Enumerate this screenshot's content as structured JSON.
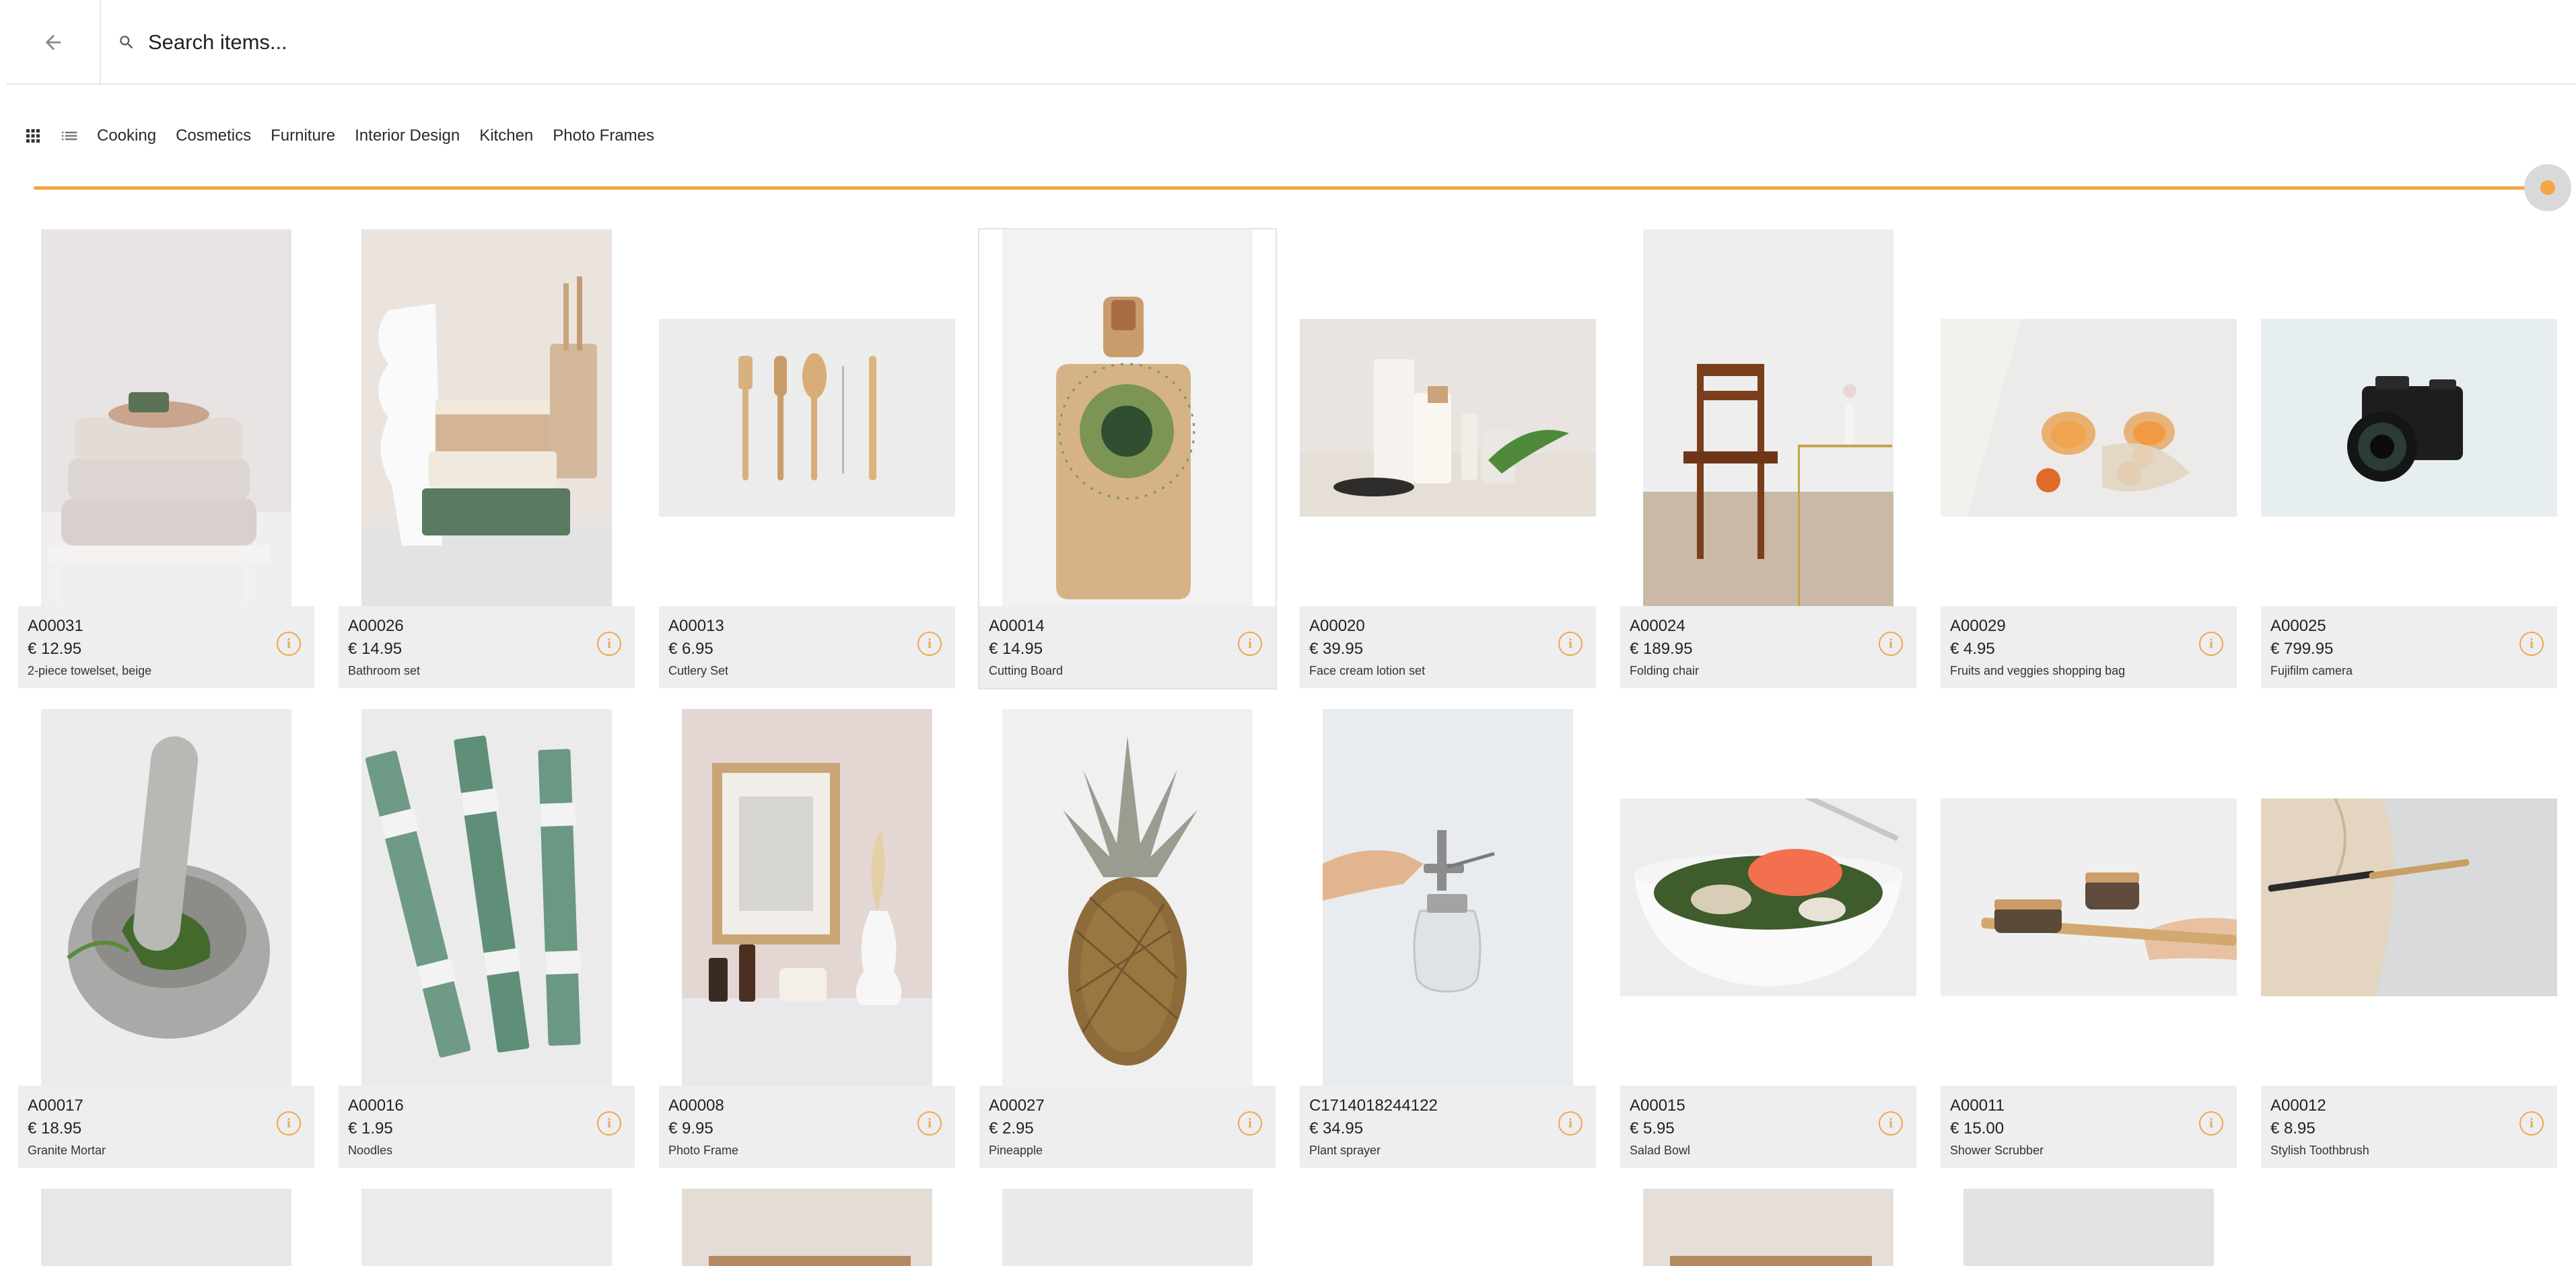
{
  "header": {
    "back_icon": "arrow-left-icon",
    "search_icon": "search-icon",
    "search_placeholder": "Search items..."
  },
  "toolbar": {
    "grid_view_icon": "grid-view-icon",
    "list_view_icon": "list-view-icon",
    "tabs": [
      "Cooking",
      "Cosmetics",
      "Furniture",
      "Interior Design",
      "Kitchen",
      "Photo Frames"
    ]
  },
  "slider": {
    "value_fraction": 1.0,
    "accent_color": "#f6a545"
  },
  "items": [
    {
      "sku": "A00031",
      "price": "€ 12.95",
      "name": "2-piece towelset, beige"
    },
    {
      "sku": "A00026",
      "price": "€ 14.95",
      "name": "Bathroom set"
    },
    {
      "sku": "A00013",
      "price": "€ 6.95",
      "name": "Cutlery Set"
    },
    {
      "sku": "A00014",
      "price": "€ 14.95",
      "name": "Cutting Board"
    },
    {
      "sku": "A00020",
      "price": "€ 39.95",
      "name": "Face cream lotion set"
    },
    {
      "sku": "A00024",
      "price": "€ 189.95",
      "name": "Folding chair"
    },
    {
      "sku": "A00029",
      "price": "€ 4.95",
      "name": "Fruits and veggies shopping bag"
    },
    {
      "sku": "A00025",
      "price": "€ 799.95",
      "name": "Fujifilm camera"
    },
    {
      "sku": "A00017",
      "price": "€ 18.95",
      "name": "Granite Mortar"
    },
    {
      "sku": "A00016",
      "price": "€ 1.95",
      "name": "Noodles"
    },
    {
      "sku": "A00008",
      "price": "€ 9.95",
      "name": "Photo Frame"
    },
    {
      "sku": "A00027",
      "price": "€ 2.95",
      "name": "Pineapple"
    },
    {
      "sku": "C1714018244122",
      "price": "€ 34.95",
      "name": "Plant sprayer"
    },
    {
      "sku": "A00015",
      "price": "€ 5.95",
      "name": "Salad Bowl"
    },
    {
      "sku": "A00011",
      "price": "€ 15.00",
      "name": "Shower Scrubber"
    },
    {
      "sku": "A00012",
      "price": "€ 8.95",
      "name": "Stylish Toothbrush"
    }
  ],
  "info_icon": "info-icon",
  "info_glyph": "i"
}
